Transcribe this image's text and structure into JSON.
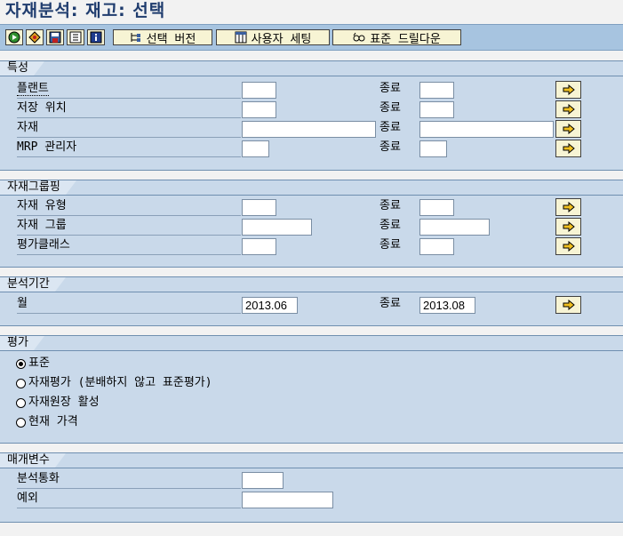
{
  "window": {
    "title": "자재분석: 재고: 선택"
  },
  "toolbar": {
    "icons": [
      "execute-icon",
      "variant-icon",
      "save-icon",
      "multiple-selection-icon",
      "info-icon"
    ],
    "select_version": "선택 버전",
    "user_settings": "사용자 세팅",
    "standard_drilldown": "표준 드릴다운"
  },
  "characteristics": {
    "title": "특성",
    "rows": [
      {
        "label": "플랜트",
        "from": "",
        "to_label": "종료",
        "to": ""
      },
      {
        "label": "저장 위치",
        "from": "",
        "to_label": "종료",
        "to": ""
      },
      {
        "label": "자재",
        "from": "",
        "to_label": "종료",
        "to": ""
      },
      {
        "label": "MRP 관리자",
        "from": "",
        "to_label": "종료",
        "to": ""
      }
    ]
  },
  "material_groupings": {
    "title": "자재그룹핑",
    "rows": [
      {
        "label": "자재 유형",
        "from": "",
        "to_label": "종료",
        "to": ""
      },
      {
        "label": "자재 그룹",
        "from": "",
        "to_label": "종료",
        "to": ""
      },
      {
        "label": "평가클래스",
        "from": "",
        "to_label": "종료",
        "to": ""
      }
    ]
  },
  "analysis_period": {
    "title": "분석기간",
    "month_label": "월",
    "from": "2013.06",
    "to_label": "종료",
    "to": "2013.08"
  },
  "valuation": {
    "title": "평가",
    "options": [
      {
        "label": "표준",
        "selected": true
      },
      {
        "label": "자재평가 (분배하지 않고 표준평가)",
        "selected": false
      },
      {
        "label": "자재원장 활성",
        "selected": false
      },
      {
        "label": "현재 가격",
        "selected": false
      }
    ]
  },
  "parameters": {
    "title": "매개변수",
    "currency_label": "분석통화",
    "currency": "",
    "exception_label": "예외",
    "exception": ""
  },
  "colors": {
    "title": "#1f3c6e",
    "toolbar": "#a7c4e0",
    "section": "#c9d9ea",
    "button": "#f7f4d4"
  }
}
